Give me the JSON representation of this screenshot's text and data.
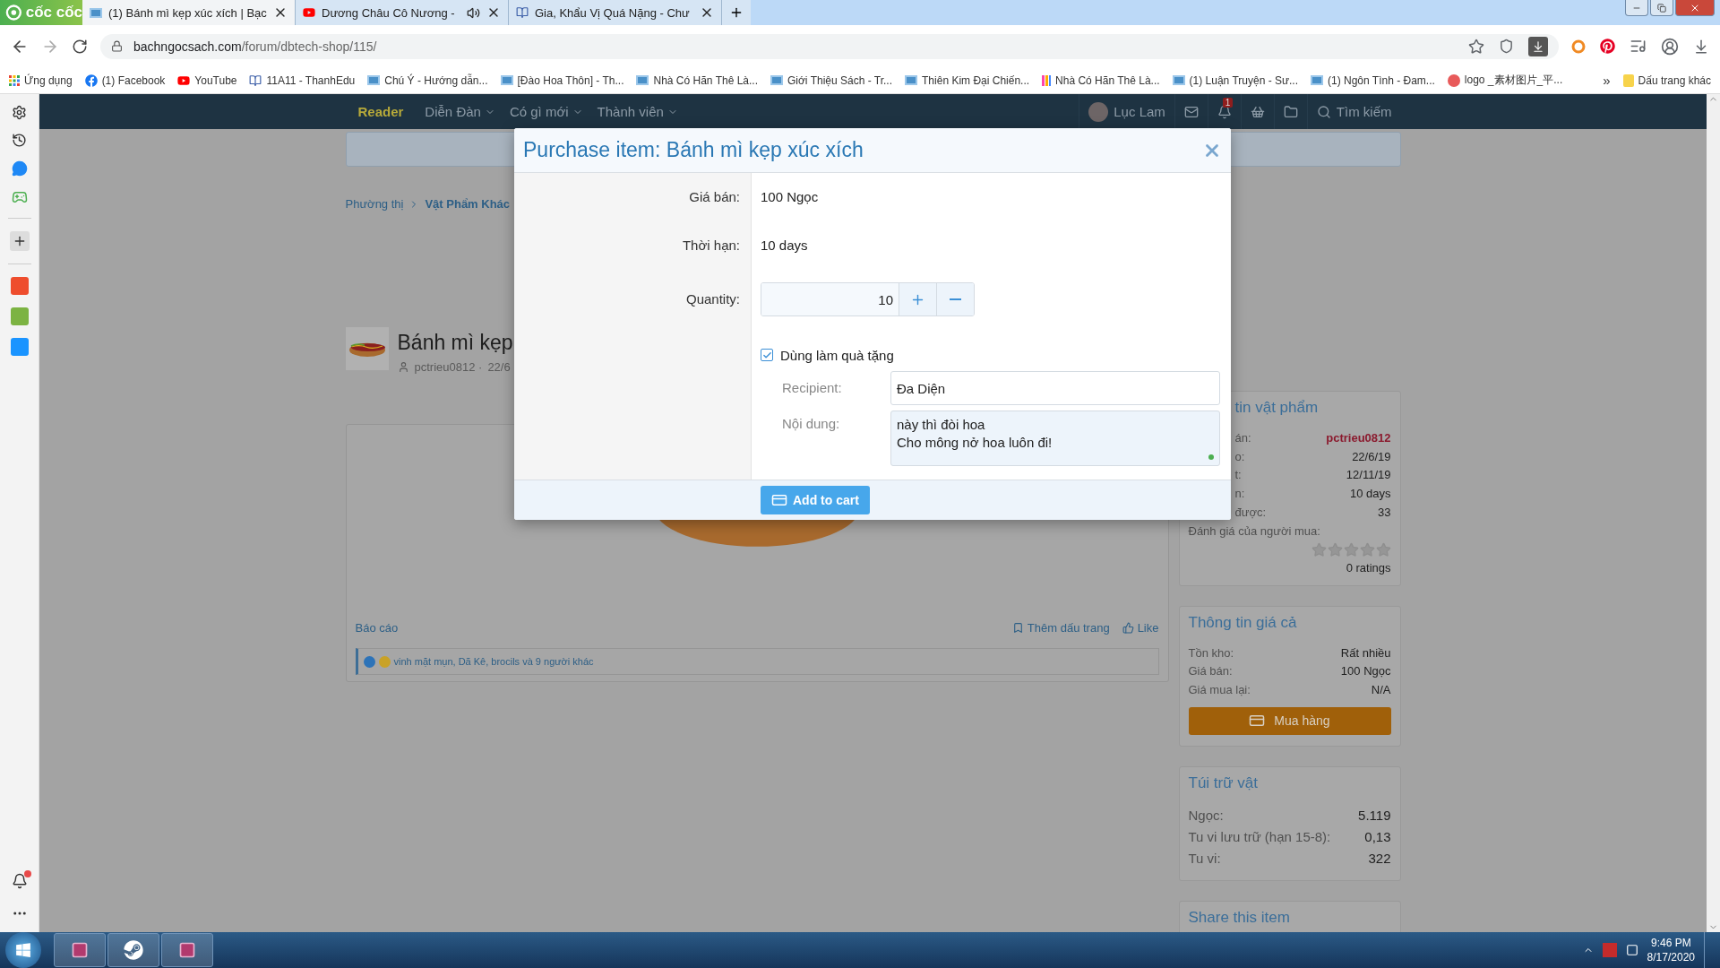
{
  "browser": {
    "logo": "cốc cốc",
    "tabs": [
      {
        "title": "(1) Bánh mì kẹp xúc xích | Bạc",
        "audio": false,
        "selected": true
      },
      {
        "title": "Dương Châu Cô Nương -",
        "audio": true,
        "selected": false
      },
      {
        "title": "Gia, Khẩu Vị Quá Nặng - Chư",
        "audio": false,
        "selected": false
      }
    ],
    "address": {
      "domain": "bachngocsach.com",
      "path": "/forum/dbtech-shop/115/"
    },
    "bookmarks": [
      {
        "label": "Ứng dụng",
        "kind": "apps"
      },
      {
        "label": "(1) Facebook",
        "kind": "facebook"
      },
      {
        "label": "YouTube",
        "kind": "youtube"
      },
      {
        "label": "11A11 - ThanhEdu",
        "kind": "book"
      },
      {
        "label": "Chú Ý - Hướng dẫn...",
        "kind": "site"
      },
      {
        "label": "[Đào Hoa Thôn] - Th...",
        "kind": "site"
      },
      {
        "label": "Nhà Có Hãn Thê Là...",
        "kind": "site"
      },
      {
        "label": "Giới Thiệu Sách - Tr...",
        "kind": "site"
      },
      {
        "label": "Thiên Kim Đại Chiến...",
        "kind": "site"
      },
      {
        "label": "Nhà Có Hãn Thê Là...",
        "kind": "colorful"
      },
      {
        "label": "(1) Luận Truyện - Sư...",
        "kind": "site"
      },
      {
        "label": "(1) Ngôn Tình - Đam...",
        "kind": "site"
      },
      {
        "label": "logo _素材图片_平...",
        "kind": "logo"
      }
    ],
    "more_bookmarks": "»",
    "other_bookmarks": "Dấu trang khác",
    "notifications_unread": true
  },
  "nav": {
    "brand": "Reader",
    "menus": [
      "Diễn Đàn",
      "Có gì mới",
      "Thành viên"
    ],
    "user": "Lục Lam",
    "alert_count": "1",
    "search": "Tìm kiếm"
  },
  "breadcrumb": [
    "Phường thị",
    "Vật Phẩm Khác"
  ],
  "item": {
    "title": "Bánh mì kẹp",
    "author": "pctrieu0812 ·",
    "date": "22/6"
  },
  "post": {
    "report": "Báo cáo",
    "bookmark": "Thêm dấu trang",
    "like": "Like",
    "reactions": "vinh mặt mụn, Dã Kê, brocils và 9 người khác"
  },
  "sidebar": [
    {
      "title": "tin vật phẩm",
      "rows": [
        {
          "label": "án:",
          "value": "pctrieu0812",
          "kind": "user"
        },
        {
          "label": "o:",
          "value": "22/6/19",
          "kind": "plain"
        },
        {
          "label": "t:",
          "value": "12/11/19",
          "kind": "plain"
        },
        {
          "label": "n:",
          "value": "10 days",
          "kind": "plain"
        },
        {
          "label": "được:",
          "value": "33",
          "kind": "plain"
        }
      ],
      "rating": {
        "label": "Đánh giá của người mua:",
        "stars": 0,
        "count": "0 ratings"
      }
    },
    {
      "title": "Thông tin giá cả",
      "rows": [
        {
          "label": "Tồn kho:",
          "value": "Rất nhiều",
          "kind": "plain"
        },
        {
          "label": "Giá bán:",
          "value": "100 Ngọc",
          "kind": "plain"
        },
        {
          "label": "Giá mua lại:",
          "value": "N/A",
          "kind": "plain"
        }
      ],
      "button": "Mua hàng"
    },
    {
      "title": "Túi trữ vật",
      "rows": [
        {
          "label": "Ngọc:",
          "value": "5.119",
          "kind": "large"
        },
        {
          "label": "Tu vi lưu trữ (hạn 15-8):",
          "value": "0,13",
          "kind": "large"
        },
        {
          "label": "Tu vi:",
          "value": "322",
          "kind": "large"
        }
      ]
    },
    {
      "title": "Share this item"
    }
  ],
  "modal": {
    "title": "Purchase item: Bánh mì kẹp xúc xích",
    "fields": [
      {
        "label": "Giá bán:",
        "value": "100 Ngọc"
      },
      {
        "label": "Thời hạn:",
        "value": "10 days"
      }
    ],
    "quantity": {
      "label": "Quantity:",
      "value": "10"
    },
    "gift": {
      "label": "Dùng làm quà tặng",
      "checked": true,
      "recipient_label": "Recipient:",
      "recipient": "Đa Diện",
      "message_label": "Nội dung:",
      "message": "này thì đòi hoa\nCho mông nở hoa luôn đi!"
    },
    "submit": "Add to cart"
  },
  "taskbar": {
    "time": "9:46 PM",
    "date": "8/17/2020"
  }
}
